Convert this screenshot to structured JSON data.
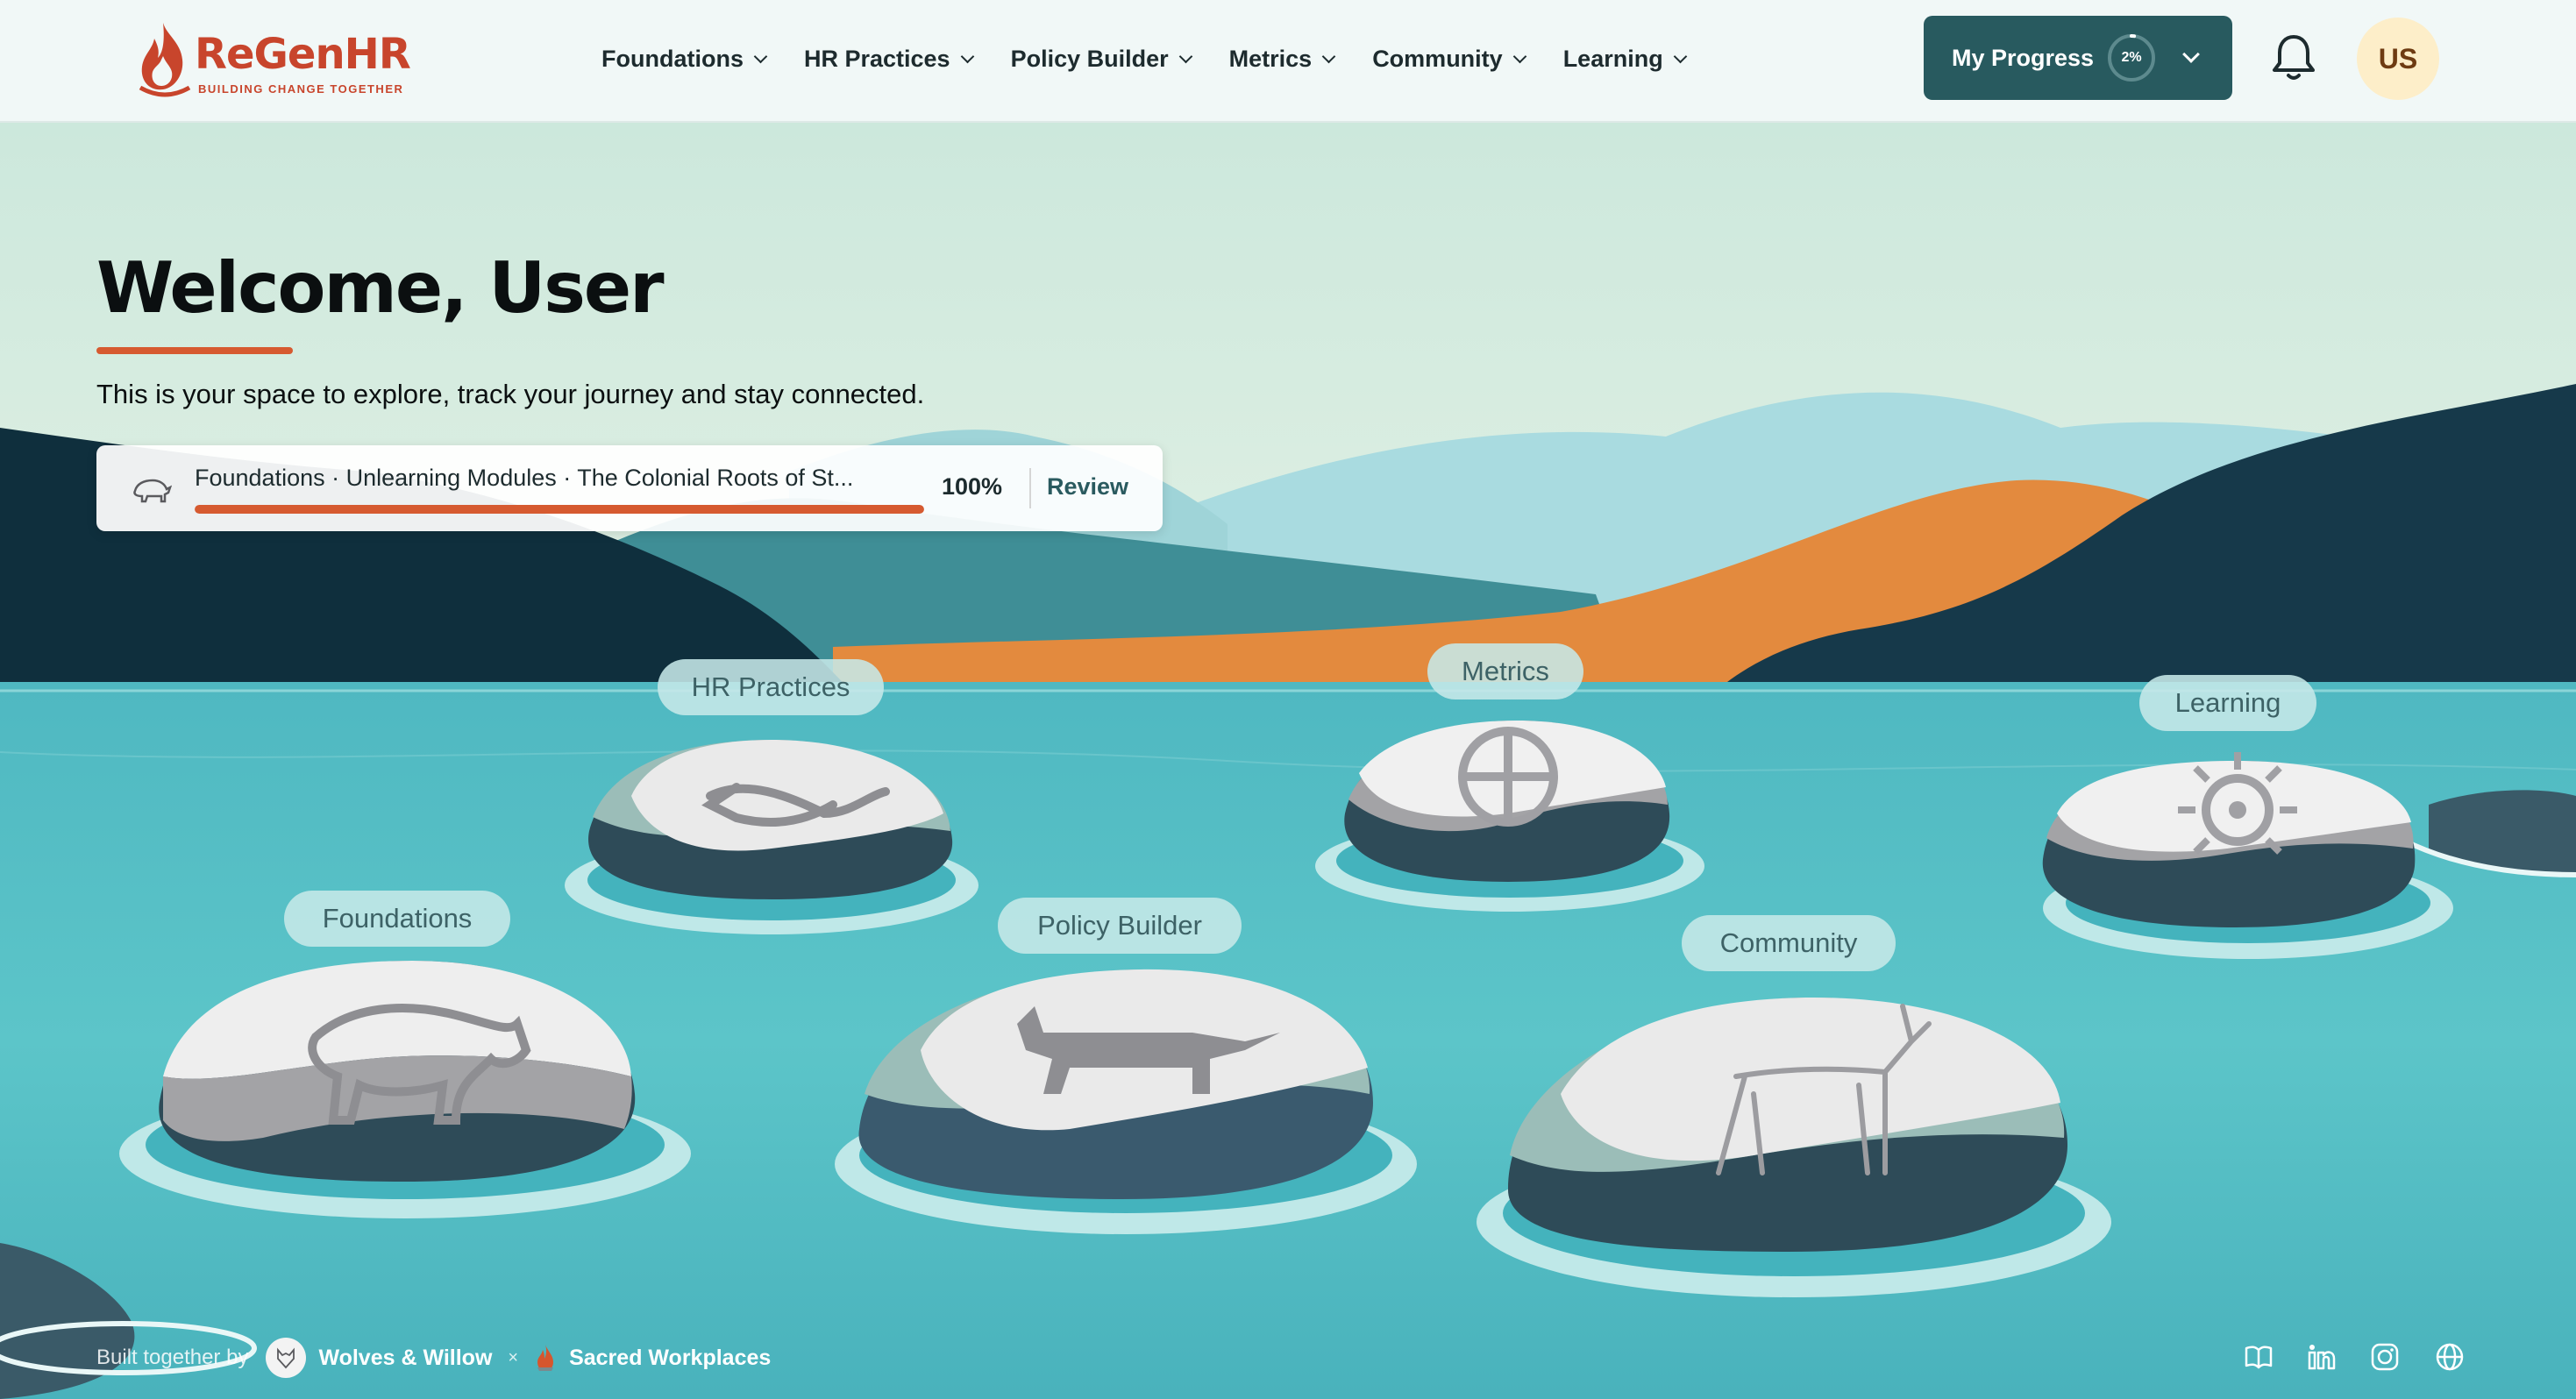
{
  "brand": {
    "name": "ReGenHR",
    "tagline": "BUILDING CHANGE TOGETHER",
    "color": "#c8452c"
  },
  "nav": {
    "items": [
      {
        "label": "Foundations"
      },
      {
        "label": "HR Practices"
      },
      {
        "label": "Policy Builder"
      },
      {
        "label": "Metrics"
      },
      {
        "label": "Community"
      },
      {
        "label": "Learning"
      }
    ]
  },
  "progress": {
    "label": "My Progress",
    "percent_text": "2%",
    "value": 0.02
  },
  "user": {
    "initials": "US"
  },
  "welcome": {
    "title": "Welcome, User",
    "subtitle": "This is your space to explore, track your journey and stay connected."
  },
  "resume": {
    "path": "Foundations · Unlearning Modules · The Colonial Roots of St...",
    "percent_text": "100%",
    "value": 1.0,
    "action": "Review"
  },
  "stones": [
    {
      "label": "Foundations"
    },
    {
      "label": "HR Practices"
    },
    {
      "label": "Policy Builder"
    },
    {
      "label": "Metrics"
    },
    {
      "label": "Community"
    },
    {
      "label": "Learning"
    }
  ],
  "footer": {
    "prefix": "Built together by",
    "partner_one": "Wolves & Willow",
    "separator": "×",
    "partner_two": "Sacred Workplaces"
  },
  "icons": {
    "bell": "bell-icon",
    "book": "book-icon",
    "linkedin": "linkedin-icon",
    "instagram": "instagram-icon",
    "globe": "globe-icon"
  },
  "colors": {
    "primary_dark": "#285a5f",
    "accent": "#d65a30",
    "water": "#5cc4c8",
    "header_bg": "#f1f8f7"
  }
}
